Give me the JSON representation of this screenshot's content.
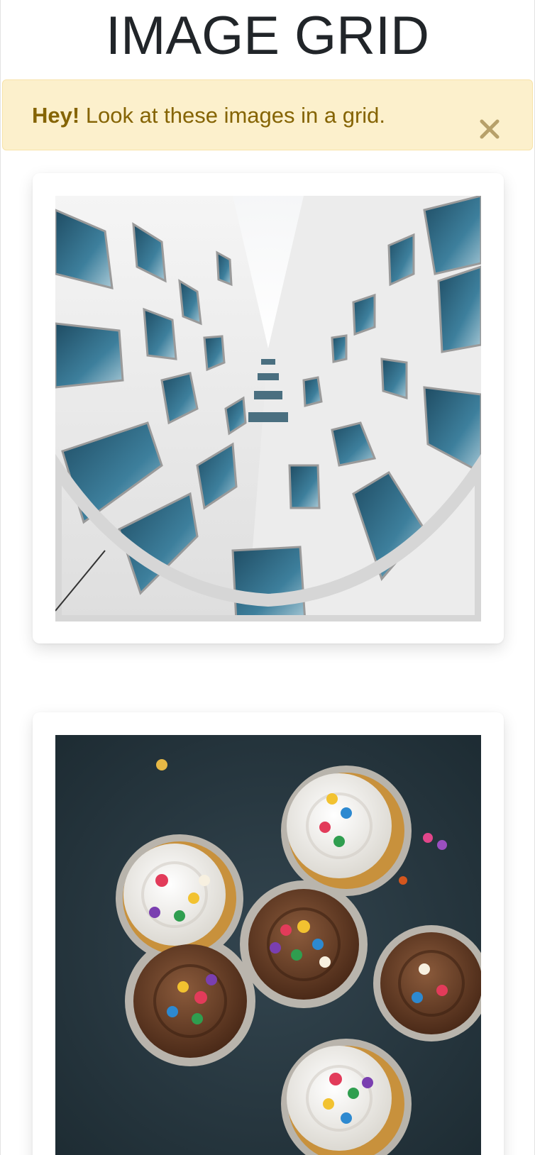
{
  "header": {
    "title": "IMAGE GRID"
  },
  "alert": {
    "strong_text": "Hey!",
    "message": " Look at these images in a grid.",
    "close_label": "×",
    "background_color": "#fcf0cc",
    "text_color": "#856404"
  },
  "images": [
    {
      "description_icon": "building-photo",
      "kind": "architecture"
    },
    {
      "description_icon": "cupcakes-photo",
      "kind": "food"
    }
  ],
  "colors": {
    "title": "#212529",
    "card_background": "#ffffff",
    "page_background": "#ffffff"
  }
}
